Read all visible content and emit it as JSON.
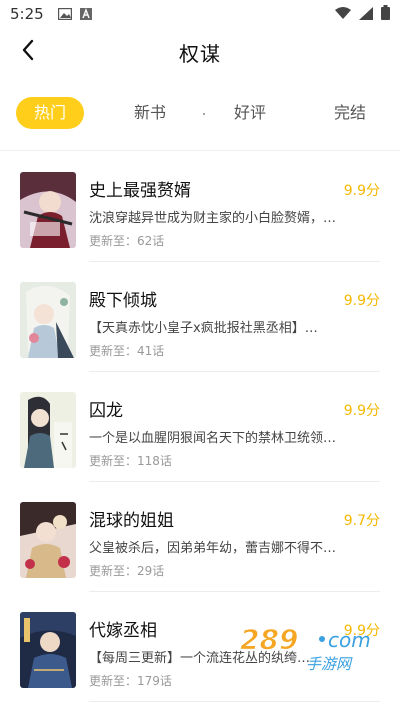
{
  "status_bar": {
    "time": "5:25",
    "icons": [
      "image-icon",
      "a-icon",
      "wifi-icon",
      "signal-icon",
      "battery-icon"
    ]
  },
  "header": {
    "title": "权谋",
    "back_icon": "chevron-left-icon"
  },
  "tabs": [
    {
      "label": "热门",
      "active": true
    },
    {
      "label": "新书",
      "active": false
    },
    {
      "label": "好评",
      "active": false
    },
    {
      "label": "完结",
      "active": false
    }
  ],
  "items": [
    {
      "title": "史上最强赘婿",
      "score": "9.9分",
      "desc": "沈浪穿越异世成为财主家的小白脸赘婿，…",
      "update": "更新至：62话"
    },
    {
      "title": "殿下倾城",
      "score": "9.9分",
      "desc": "【天真赤忱小皇子x疯批报社黑丞相】…",
      "update": "更新至：41话"
    },
    {
      "title": "囚龙",
      "score": "9.9分",
      "desc": "一个是以血腥阴狠闻名天下的禁林卫统领…",
      "update": "更新至：118话"
    },
    {
      "title": "混球的姐姐",
      "score": "9.7分",
      "desc": "父皇被杀后，因弟弟年幼，蕾吉娜不得不…",
      "update": "更新至：29话"
    },
    {
      "title": "代嫁丞相",
      "score": "9.9分",
      "desc": "【每周三更新】一个流连花丛的纨绔…",
      "update": "更新至：179话"
    }
  ],
  "colors": {
    "accent": "#ffce1a",
    "score": "#f5b800"
  },
  "watermark": {
    "text": "289.com",
    "sub": "手游网"
  }
}
